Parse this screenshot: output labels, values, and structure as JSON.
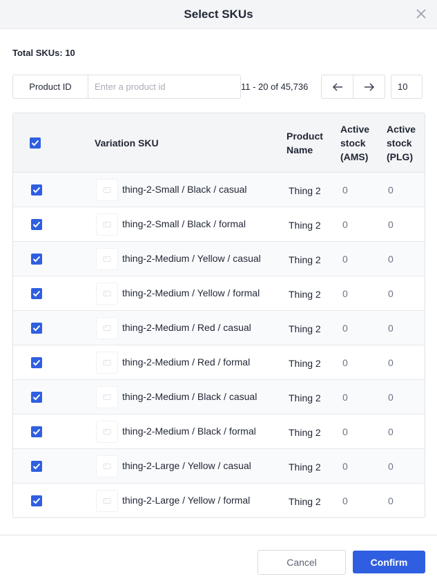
{
  "modal": {
    "title": "Select SKUs"
  },
  "summary": {
    "total_skus": "Total SKUs: 10"
  },
  "filter": {
    "field_label": "Product ID",
    "placeholder": "Enter a product id",
    "value": ""
  },
  "pagination": {
    "range_text": "11 - 20 of 45,736",
    "page_size": "10"
  },
  "table": {
    "columns": {
      "sku": "Variation SKU",
      "name": "Product Name",
      "ams": "Active stock (AMS)",
      "plg": "Active stock (PLG)"
    },
    "rows": [
      {
        "sku": "thing-2-Small / Black / casual",
        "name": "Thing 2",
        "ams": "0",
        "plg": "0"
      },
      {
        "sku": "thing-2-Small / Black / formal",
        "name": "Thing 2",
        "ams": "0",
        "plg": "0"
      },
      {
        "sku": "thing-2-Medium / Yellow / casual",
        "name": "Thing 2",
        "ams": "0",
        "plg": "0"
      },
      {
        "sku": "thing-2-Medium / Yellow / formal",
        "name": "Thing 2",
        "ams": "0",
        "plg": "0"
      },
      {
        "sku": "thing-2-Medium / Red / casual",
        "name": "Thing 2",
        "ams": "0",
        "plg": "0"
      },
      {
        "sku": "thing-2-Medium / Red / formal",
        "name": "Thing 2",
        "ams": "0",
        "plg": "0"
      },
      {
        "sku": "thing-2-Medium / Black / casual",
        "name": "Thing 2",
        "ams": "0",
        "plg": "0"
      },
      {
        "sku": "thing-2-Medium / Black / formal",
        "name": "Thing 2",
        "ams": "0",
        "plg": "0"
      },
      {
        "sku": "thing-2-Large / Yellow / casual",
        "name": "Thing 2",
        "ams": "0",
        "plg": "0"
      },
      {
        "sku": "thing-2-Large / Yellow / formal",
        "name": "Thing 2",
        "ams": "0",
        "plg": "0"
      }
    ]
  },
  "footer": {
    "cancel_label": "Cancel",
    "confirm_label": "Confirm"
  },
  "colors": {
    "accent": "#2f5fe0",
    "header_bg": "#f4f5f7"
  },
  "icons": {
    "close": "close-icon",
    "prev": "arrow-left-icon",
    "next": "arrow-right-icon",
    "checkbox": "checkbox-checked-icon",
    "thumbnail": "image-placeholder-icon"
  }
}
